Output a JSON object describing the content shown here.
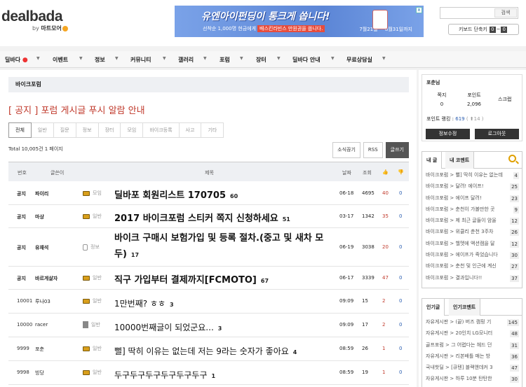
{
  "header": {
    "logo": "dealbada",
    "logo_sub_by": "by",
    "logo_sub_brand": "마트모어",
    "banner": {
      "title": "유엔아이펀딩이 통크게 쏩니다!",
      "sub_pre": "선착순 1,000명 현금에게",
      "sub_highlight": "배스킨라빈스 만원권을 쏩니다.",
      "date": "7월21일 ~ 8월31일까지",
      "close": "x"
    },
    "search_button": "검색",
    "kb_label": "키보드 단축키",
    "kb_key1": "0",
    "kb_sep": "~",
    "kb_key2": "0"
  },
  "nav": {
    "items": [
      "딜바다",
      "이벤트",
      "정보",
      "커뮤니티",
      "갤러리",
      "포럼",
      "장터",
      "딜바다 안내",
      "무료상담실"
    ],
    "dot": "●"
  },
  "board": {
    "breadcrumb": "바이크포럼",
    "notice_title": "[ 공지 ] 포럼 게시글 푸시 알람 안내",
    "tabs": [
      "전체",
      "일반",
      "질문",
      "정보",
      "장터",
      "모임",
      "바이크등록",
      "사고",
      "기타"
    ],
    "total": "Total 10,005건 1 페이지",
    "buttons": {
      "subscribe": "소식끊기",
      "rss": "RSS",
      "write": "글쓰기"
    },
    "columns": {
      "num": "번호",
      "author": "글쓴이",
      "title": "제목",
      "date": "날짜",
      "views": "조회",
      "like": "👍",
      "dislike": "👎"
    },
    "rows": [
      {
        "num": "공지",
        "author": "파이리",
        "cat": "모임",
        "title": "딜바포 회원리스트 170705",
        "comments": "60",
        "date": "06-18",
        "views": "4695",
        "likes": "40",
        "dislikes": "0",
        "notice": true,
        "icon": "camera-icon"
      },
      {
        "num": "공지",
        "author": "마상",
        "cat": "일반",
        "title": "2017 바이크포럼 스티커 쪽지 신청하세요",
        "comments": "51",
        "date": "03-17",
        "views": "1342",
        "likes": "35",
        "dislikes": "0",
        "notice": true,
        "icon": "camera-icon"
      },
      {
        "num": "공지",
        "author": "유재석",
        "cat": "정보",
        "title": "바이크 구매시 보험가입 및 등록 절차.(중고 및 새차 모두)",
        "comments": "17",
        "date": "06-19",
        "views": "3038",
        "likes": "20",
        "dislikes": "0",
        "notice": true,
        "icon": "lock-icon"
      },
      {
        "num": "공지",
        "author": "바르게살자",
        "cat": "일반",
        "title": "직구 가입부터 결제까지[FCMOTO]",
        "comments": "67",
        "date": "06-17",
        "views": "3339",
        "likes": "47",
        "dislikes": "0",
        "notice": true,
        "icon": "camera-icon"
      },
      {
        "num": "10001",
        "author": "루나03",
        "cat": "일반",
        "title": "1만번째? ㅎㅎ",
        "comments": "3",
        "date": "09:09",
        "views": "15",
        "likes": "2",
        "dislikes": "0",
        "notice": false,
        "icon": "camera-icon"
      },
      {
        "num": "10000",
        "author": "racer",
        "cat": "일반",
        "title": "10000번째글이 되었군요...",
        "comments": "3",
        "date": "09:09",
        "views": "17",
        "likes": "2",
        "dislikes": "0",
        "notice": false,
        "icon": "document-icon"
      },
      {
        "num": "9999",
        "author": "포춘",
        "cat": "일반",
        "title": "뻘] 딱히 이유는 없는데 저는 9라는 숫자가 좋아요",
        "comments": "4",
        "date": "08:59",
        "views": "26",
        "likes": "1",
        "dislikes": "0",
        "notice": false,
        "icon": "camera-icon"
      },
      {
        "num": "9998",
        "author": "빙당",
        "cat": "일반",
        "title": "두구두구두구두구두구두구",
        "comments": "1",
        "date": "08:59",
        "views": "19",
        "likes": "1",
        "dislikes": "0",
        "notice": false,
        "icon": "camera-icon"
      }
    ]
  },
  "sidebar": {
    "profile": {
      "name": "포춘님",
      "msg_label": "쪽지",
      "msg_val": "0",
      "point_label": "포인트",
      "point_val": "2,096",
      "scrap": "스크랩",
      "rank_pre": "포인트 랭킹 : ",
      "rank_val": "619",
      "rank_change": "( ⬆14 )",
      "edit_btn": "정보수정",
      "logout_btn": "로그아웃"
    },
    "my_widget": {
      "tab1": "내 글",
      "tab2": "내 코멘트",
      "items": [
        {
          "t": "바이크포럼 > 뻘] 딱히 이유는 없는데",
          "c": "4"
        },
        {
          "t": "바이크포럼 > 달려! 에이프!",
          "c": "25"
        },
        {
          "t": "바이크포럼 > 에이프 달려!",
          "c": "23"
        },
        {
          "t": "바이크포럼 > 춘천이 가볼만한 곳",
          "c": "9"
        },
        {
          "t": "바이크포럼 > 제 최근 글들이 암울",
          "c": "12"
        },
        {
          "t": "바이크포럼 > 위클리 춘천 3주차",
          "c": "26"
        },
        {
          "t": "바이크포럼 > 헬멧에 액션캠을 달",
          "c": "12"
        },
        {
          "t": "바이크포럼 > 에이프가 죽었습니다",
          "c": "30"
        },
        {
          "t": "바이크포럼 > 춘천 및 인근에 계신",
          "c": "27"
        },
        {
          "t": "바이크포럼 > 결과입니다!!",
          "c": "37"
        }
      ]
    },
    "hot_widget": {
      "tab1": "인기글",
      "tab2": "인기코멘트",
      "items": [
        {
          "t": "자유게시판 > (끝) 버즈 캠핑 기",
          "c": "145"
        },
        {
          "t": "자유게시판 > 20인치 LG모니터",
          "c": "48"
        },
        {
          "t": "골프포럼 > 그 어렵다는 헤드 던",
          "c": "31"
        },
        {
          "t": "자유게시판 > 리본배틀 매는 방",
          "c": "36"
        },
        {
          "t": "국내핫딜 > [큐텐] 블랙앤데커 3",
          "c": "47"
        },
        {
          "t": "자유게시판 > 하루 10분 탄탄한",
          "c": "30"
        }
      ]
    }
  }
}
